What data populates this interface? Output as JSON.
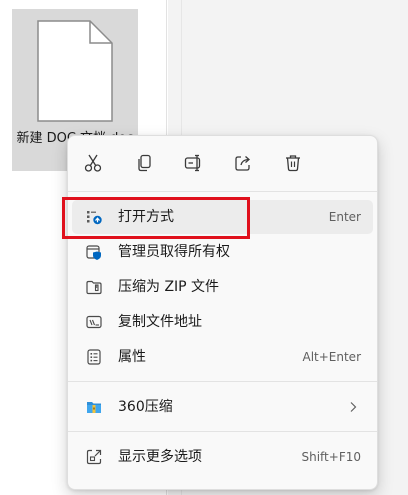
{
  "file": {
    "name": "新建 DOC 文档.doc",
    "icon": "document-file-icon"
  },
  "menu": {
    "quick_actions": [
      {
        "name": "cut",
        "icon": "scissors-icon"
      },
      {
        "name": "copy",
        "icon": "copy-icon"
      },
      {
        "name": "rename",
        "icon": "rename-icon"
      },
      {
        "name": "share",
        "icon": "share-icon"
      },
      {
        "name": "delete",
        "icon": "trash-icon"
      }
    ],
    "items": [
      {
        "label": "打开方式",
        "shortcut": "Enter",
        "icon": "open-with-icon",
        "hovered": true
      },
      {
        "label": "管理员取得所有权",
        "shortcut": "",
        "icon": "shield-ownership-icon"
      },
      {
        "label": "压缩为 ZIP 文件",
        "shortcut": "",
        "icon": "zip-archive-icon"
      },
      {
        "label": "复制文件地址",
        "shortcut": "",
        "icon": "copy-path-icon"
      },
      {
        "label": "属性",
        "shortcut": "Alt+Enter",
        "icon": "properties-icon"
      },
      {
        "label": "360压缩",
        "shortcut": "",
        "icon": "archive-360-icon",
        "submenu": true
      },
      {
        "label": "显示更多选项",
        "shortcut": "Shift+F10",
        "icon": "more-options-icon"
      }
    ]
  },
  "colors": {
    "accent": "#0067c0",
    "highlight_border": "#e0101c",
    "menu_bg": "#f9f9f9"
  }
}
